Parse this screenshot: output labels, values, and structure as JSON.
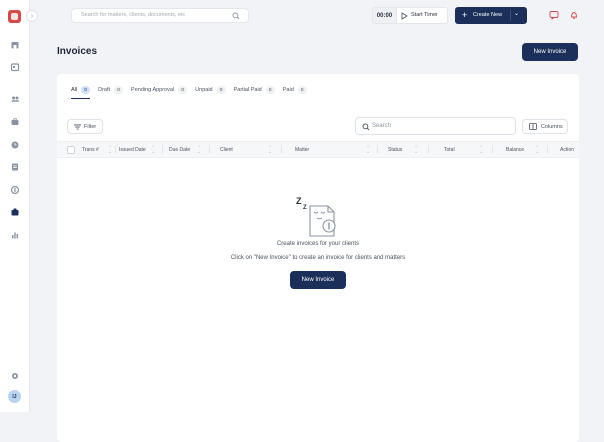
{
  "topbar": {
    "search_placeholder": "Search for matters, clients, documents, etc",
    "timer_value": "00:00",
    "start_timer_label": "Start Timer",
    "create_new_label": "Create New"
  },
  "sidebar": {
    "avatar_initials": "IJ",
    "items": [
      {
        "icon": "home-icon"
      },
      {
        "icon": "calendar-icon"
      },
      {
        "icon": "contacts-icon"
      },
      {
        "icon": "briefcase-icon"
      },
      {
        "icon": "clock-icon"
      },
      {
        "icon": "document-icon"
      },
      {
        "icon": "dollar-icon"
      },
      {
        "icon": "invoice-icon",
        "active": true
      },
      {
        "icon": "reports-icon"
      }
    ]
  },
  "page": {
    "title": "Invoices",
    "new_invoice_label": "New Invoice"
  },
  "tabs": [
    {
      "label": "All",
      "count": "0",
      "active": true
    },
    {
      "label": "Draft",
      "count": "0"
    },
    {
      "label": "Pending Approval",
      "count": "0"
    },
    {
      "label": "Unpaid",
      "count": "0"
    },
    {
      "label": "Partial Paid",
      "count": "0"
    },
    {
      "label": "Paid",
      "count": "0"
    }
  ],
  "toolbar": {
    "filter_label": "Filter",
    "search_placeholder": "Search",
    "columns_label": "Columns"
  },
  "table": {
    "columns": [
      "Trans #",
      "Issued Date",
      "Due Date",
      "Client",
      "Matter",
      "Status",
      "Total",
      "Balance",
      "Action"
    ]
  },
  "empty_state": {
    "title": "Create invoices for your clients",
    "subtitle": "Click on \"New Invoice\" to create an invoice for clients and matters",
    "button_label": "New Invoice"
  },
  "colors": {
    "primary": "#1a2f5a",
    "tab_badge_active": "#cfe1f7",
    "background": "#f2f3f7"
  }
}
